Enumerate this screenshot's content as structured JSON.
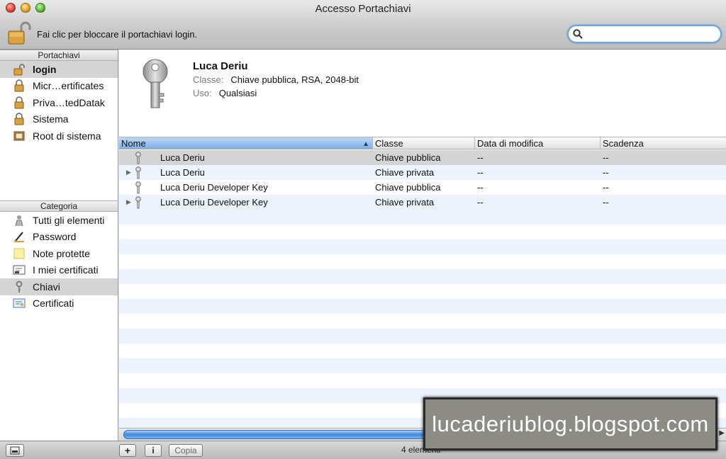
{
  "window": {
    "title": "Accesso Portachiavi"
  },
  "toolbar": {
    "lock_text": "Fai clic per bloccare il portachiavi login.",
    "search_placeholder": ""
  },
  "sidebar": {
    "keychains_header": "Portachiavi",
    "keychains": [
      {
        "label": "login",
        "icon": "unlocked-padlock-icon"
      },
      {
        "label": "Micr…ertificates",
        "icon": "padlock-icon"
      },
      {
        "label": "Priva…tedDatak",
        "icon": "padlock-icon"
      },
      {
        "label": "Sistema",
        "icon": "padlock-icon"
      },
      {
        "label": "Root di sistema",
        "icon": "cabinet-icon"
      }
    ],
    "category_header": "Categoria",
    "categories": [
      {
        "label": "Tutti gli elementi",
        "icon": "people-icon"
      },
      {
        "label": "Password",
        "icon": "pencil-icon"
      },
      {
        "label": "Note protette",
        "icon": "note-icon"
      },
      {
        "label": "I miei certificati",
        "icon": "certificate-icon"
      },
      {
        "label": "Chiavi",
        "icon": "key-icon"
      },
      {
        "label": "Certificati",
        "icon": "certificate-icon"
      }
    ]
  },
  "details": {
    "name": "Luca Deriu",
    "class_label": "Classe:",
    "class_value": "Chiave pubblica, RSA, 2048-bit",
    "use_label": "Uso:",
    "use_value": "Qualsiasi"
  },
  "table": {
    "columns": [
      "Nome",
      "Classe",
      "Data di modifica",
      "Scadenza"
    ],
    "rows": [
      {
        "name": "Luca Deriu",
        "class": "Chiave pubblica",
        "modified": "--",
        "expiry": "--"
      },
      {
        "name": "Luca Deriu",
        "class": "Chiave privata",
        "modified": "--",
        "expiry": "--"
      },
      {
        "name": "Luca Deriu Developer Key",
        "class": "Chiave pubblica",
        "modified": "--",
        "expiry": "--"
      },
      {
        "name": "Luca Deriu Developer Key",
        "class": "Chiave privata",
        "modified": "--",
        "expiry": "--"
      }
    ]
  },
  "bottombar": {
    "add_label": "+",
    "info_label": "i",
    "copy_label": "Copia",
    "count": "4 elementi"
  },
  "watermark": "lucaderiublog.blogspot.com",
  "colors": {
    "selection": "#d4d4d4",
    "stripe": "#edf3fc",
    "accent": "#7fb0e6"
  }
}
